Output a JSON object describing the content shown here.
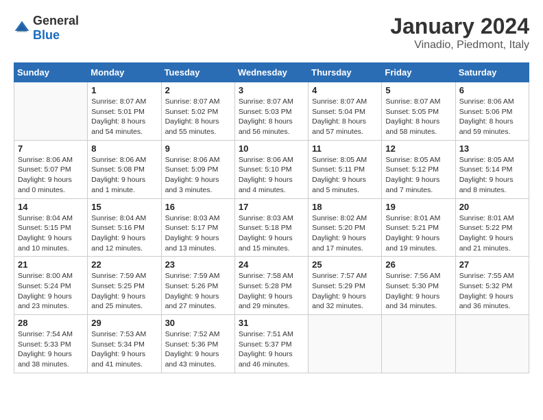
{
  "logo": {
    "general": "General",
    "blue": "Blue"
  },
  "title": "January 2024",
  "subtitle": "Vinadio, Piedmont, Italy",
  "days_of_week": [
    "Sunday",
    "Monday",
    "Tuesday",
    "Wednesday",
    "Thursday",
    "Friday",
    "Saturday"
  ],
  "weeks": [
    [
      {
        "day": "",
        "sunrise": "",
        "sunset": "",
        "daylight": ""
      },
      {
        "day": "1",
        "sunrise": "Sunrise: 8:07 AM",
        "sunset": "Sunset: 5:01 PM",
        "daylight": "Daylight: 8 hours and 54 minutes."
      },
      {
        "day": "2",
        "sunrise": "Sunrise: 8:07 AM",
        "sunset": "Sunset: 5:02 PM",
        "daylight": "Daylight: 8 hours and 55 minutes."
      },
      {
        "day": "3",
        "sunrise": "Sunrise: 8:07 AM",
        "sunset": "Sunset: 5:03 PM",
        "daylight": "Daylight: 8 hours and 56 minutes."
      },
      {
        "day": "4",
        "sunrise": "Sunrise: 8:07 AM",
        "sunset": "Sunset: 5:04 PM",
        "daylight": "Daylight: 8 hours and 57 minutes."
      },
      {
        "day": "5",
        "sunrise": "Sunrise: 8:07 AM",
        "sunset": "Sunset: 5:05 PM",
        "daylight": "Daylight: 8 hours and 58 minutes."
      },
      {
        "day": "6",
        "sunrise": "Sunrise: 8:06 AM",
        "sunset": "Sunset: 5:06 PM",
        "daylight": "Daylight: 8 hours and 59 minutes."
      }
    ],
    [
      {
        "day": "7",
        "sunrise": "Sunrise: 8:06 AM",
        "sunset": "Sunset: 5:07 PM",
        "daylight": "Daylight: 9 hours and 0 minutes."
      },
      {
        "day": "8",
        "sunrise": "Sunrise: 8:06 AM",
        "sunset": "Sunset: 5:08 PM",
        "daylight": "Daylight: 9 hours and 1 minute."
      },
      {
        "day": "9",
        "sunrise": "Sunrise: 8:06 AM",
        "sunset": "Sunset: 5:09 PM",
        "daylight": "Daylight: 9 hours and 3 minutes."
      },
      {
        "day": "10",
        "sunrise": "Sunrise: 8:06 AM",
        "sunset": "Sunset: 5:10 PM",
        "daylight": "Daylight: 9 hours and 4 minutes."
      },
      {
        "day": "11",
        "sunrise": "Sunrise: 8:05 AM",
        "sunset": "Sunset: 5:11 PM",
        "daylight": "Daylight: 9 hours and 5 minutes."
      },
      {
        "day": "12",
        "sunrise": "Sunrise: 8:05 AM",
        "sunset": "Sunset: 5:12 PM",
        "daylight": "Daylight: 9 hours and 7 minutes."
      },
      {
        "day": "13",
        "sunrise": "Sunrise: 8:05 AM",
        "sunset": "Sunset: 5:14 PM",
        "daylight": "Daylight: 9 hours and 8 minutes."
      }
    ],
    [
      {
        "day": "14",
        "sunrise": "Sunrise: 8:04 AM",
        "sunset": "Sunset: 5:15 PM",
        "daylight": "Daylight: 9 hours and 10 minutes."
      },
      {
        "day": "15",
        "sunrise": "Sunrise: 8:04 AM",
        "sunset": "Sunset: 5:16 PM",
        "daylight": "Daylight: 9 hours and 12 minutes."
      },
      {
        "day": "16",
        "sunrise": "Sunrise: 8:03 AM",
        "sunset": "Sunset: 5:17 PM",
        "daylight": "Daylight: 9 hours and 13 minutes."
      },
      {
        "day": "17",
        "sunrise": "Sunrise: 8:03 AM",
        "sunset": "Sunset: 5:18 PM",
        "daylight": "Daylight: 9 hours and 15 minutes."
      },
      {
        "day": "18",
        "sunrise": "Sunrise: 8:02 AM",
        "sunset": "Sunset: 5:20 PM",
        "daylight": "Daylight: 9 hours and 17 minutes."
      },
      {
        "day": "19",
        "sunrise": "Sunrise: 8:01 AM",
        "sunset": "Sunset: 5:21 PM",
        "daylight": "Daylight: 9 hours and 19 minutes."
      },
      {
        "day": "20",
        "sunrise": "Sunrise: 8:01 AM",
        "sunset": "Sunset: 5:22 PM",
        "daylight": "Daylight: 9 hours and 21 minutes."
      }
    ],
    [
      {
        "day": "21",
        "sunrise": "Sunrise: 8:00 AM",
        "sunset": "Sunset: 5:24 PM",
        "daylight": "Daylight: 9 hours and 23 minutes."
      },
      {
        "day": "22",
        "sunrise": "Sunrise: 7:59 AM",
        "sunset": "Sunset: 5:25 PM",
        "daylight": "Daylight: 9 hours and 25 minutes."
      },
      {
        "day": "23",
        "sunrise": "Sunrise: 7:59 AM",
        "sunset": "Sunset: 5:26 PM",
        "daylight": "Daylight: 9 hours and 27 minutes."
      },
      {
        "day": "24",
        "sunrise": "Sunrise: 7:58 AM",
        "sunset": "Sunset: 5:28 PM",
        "daylight": "Daylight: 9 hours and 29 minutes."
      },
      {
        "day": "25",
        "sunrise": "Sunrise: 7:57 AM",
        "sunset": "Sunset: 5:29 PM",
        "daylight": "Daylight: 9 hours and 32 minutes."
      },
      {
        "day": "26",
        "sunrise": "Sunrise: 7:56 AM",
        "sunset": "Sunset: 5:30 PM",
        "daylight": "Daylight: 9 hours and 34 minutes."
      },
      {
        "day": "27",
        "sunrise": "Sunrise: 7:55 AM",
        "sunset": "Sunset: 5:32 PM",
        "daylight": "Daylight: 9 hours and 36 minutes."
      }
    ],
    [
      {
        "day": "28",
        "sunrise": "Sunrise: 7:54 AM",
        "sunset": "Sunset: 5:33 PM",
        "daylight": "Daylight: 9 hours and 38 minutes."
      },
      {
        "day": "29",
        "sunrise": "Sunrise: 7:53 AM",
        "sunset": "Sunset: 5:34 PM",
        "daylight": "Daylight: 9 hours and 41 minutes."
      },
      {
        "day": "30",
        "sunrise": "Sunrise: 7:52 AM",
        "sunset": "Sunset: 5:36 PM",
        "daylight": "Daylight: 9 hours and 43 minutes."
      },
      {
        "day": "31",
        "sunrise": "Sunrise: 7:51 AM",
        "sunset": "Sunset: 5:37 PM",
        "daylight": "Daylight: 9 hours and 46 minutes."
      },
      {
        "day": "",
        "sunrise": "",
        "sunset": "",
        "daylight": ""
      },
      {
        "day": "",
        "sunrise": "",
        "sunset": "",
        "daylight": ""
      },
      {
        "day": "",
        "sunrise": "",
        "sunset": "",
        "daylight": ""
      }
    ]
  ]
}
